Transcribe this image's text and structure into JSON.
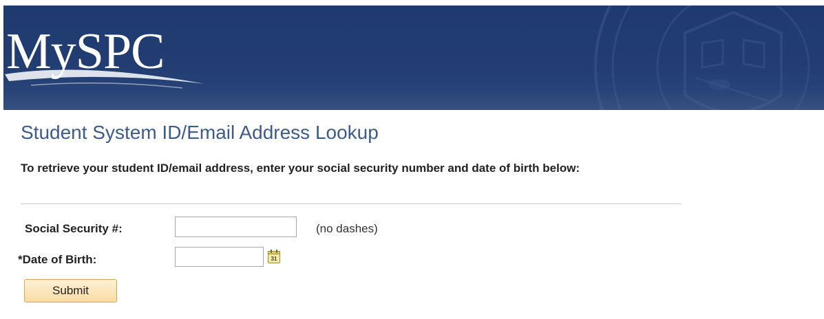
{
  "header": {
    "logo_text": "MySPC"
  },
  "page": {
    "title": "Student System ID/Email Address Lookup",
    "instructions": "To retrieve your student ID/email address, enter your social security number and date of birth below:"
  },
  "form": {
    "ssn_label": "Social Security #:",
    "ssn_value": "",
    "ssn_hint": "(no dashes)",
    "dob_label": "*Date of Birth:",
    "dob_value": "",
    "calendar_icon_text": "31",
    "submit_label": "Submit"
  },
  "colors": {
    "banner": "#1f3a6e",
    "title": "#3c5a8c",
    "button_top": "#fdf1d7",
    "button_bottom": "#f9dba1",
    "button_border": "#d9a650"
  }
}
